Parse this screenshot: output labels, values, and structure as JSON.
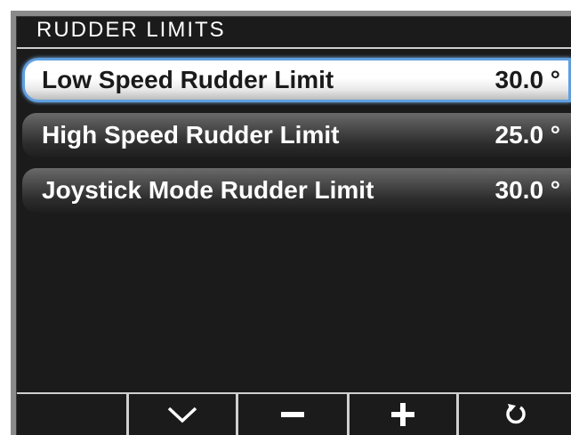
{
  "header": {
    "title": "RUDDER LIMITS"
  },
  "settings": {
    "items": [
      {
        "label": "Low Speed Rudder Limit",
        "value": "30.0 °",
        "selected": true
      },
      {
        "label": "High Speed Rudder Limit",
        "value": "25.0 °",
        "selected": false
      },
      {
        "label": "Joystick Mode Rudder Limit",
        "value": "30.0 °",
        "selected": false
      }
    ]
  },
  "softkeys": [
    {
      "icon": "blank"
    },
    {
      "icon": "chevron-down-icon"
    },
    {
      "icon": "minus-icon"
    },
    {
      "icon": "plus-icon"
    },
    {
      "icon": "back-arrow-icon"
    }
  ],
  "colors": {
    "background": "#1b1b1b",
    "selection_border": "#5f9fe0",
    "text": "#ffffff",
    "bezel": "#8a8a8a"
  }
}
